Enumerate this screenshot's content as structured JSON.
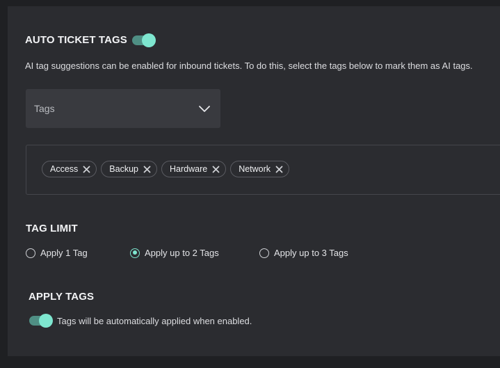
{
  "auto_tags": {
    "title": "AUTO TICKET TAGS",
    "enabled": true,
    "description": "AI tag suggestions can be enabled for inbound tickets. To do this, select the tags below to mark them as AI tags."
  },
  "tags_select": {
    "placeholder": "Tags",
    "icon": "chevron-down-icon"
  },
  "selected_tags": [
    {
      "label": "Access"
    },
    {
      "label": "Backup"
    },
    {
      "label": "Hardware"
    },
    {
      "label": "Network"
    }
  ],
  "tag_limit": {
    "title": "TAG LIMIT",
    "options": [
      {
        "label": "Apply 1 Tag",
        "checked": false
      },
      {
        "label": "Apply up to 2 Tags",
        "checked": true
      },
      {
        "label": "Apply up to 3 Tags",
        "checked": false
      }
    ]
  },
  "apply_tags": {
    "title": "APPLY TAGS",
    "enabled": true,
    "description": "Tags will be automatically applied when enabled."
  },
  "colors": {
    "accent": "#7ee6cf",
    "toggle_track": "#4f8f84",
    "panel": "#2b2c30",
    "background": "#1f2023"
  }
}
